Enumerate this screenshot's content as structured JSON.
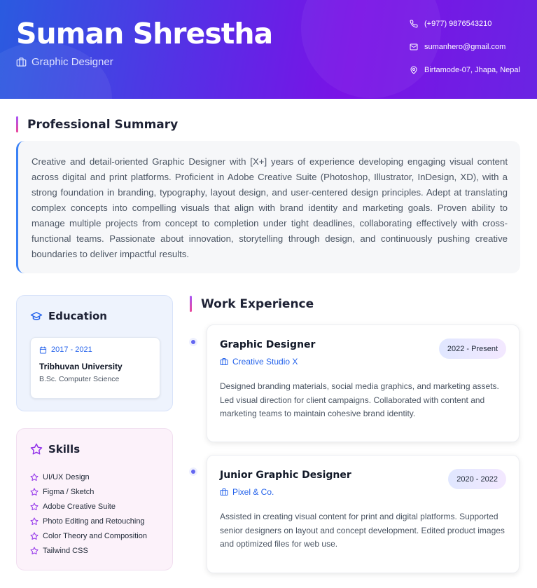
{
  "header": {
    "name": "Suman Shrestha",
    "role": "Graphic Designer",
    "contacts": [
      {
        "icon": "phone-icon",
        "text": "(+977) 9876543210"
      },
      {
        "icon": "mail-icon",
        "text": "sumanhero@gmail.com"
      },
      {
        "icon": "location-icon",
        "text": "Birtamode-07, Jhapa, Nepal"
      }
    ]
  },
  "summary": {
    "title": "Professional Summary",
    "text": "Creative and detail-oriented Graphic Designer with [X+] years of experience developing engaging visual content across digital and print platforms. Proficient in Adobe Creative Suite (Photoshop, Illustrator, InDesign, XD), with a strong foundation in branding, typography, layout design, and user-centered design principles. Adept at translating complex concepts into compelling visuals that align with brand identity and marketing goals. Proven ability to manage multiple projects from concept to completion under tight deadlines, collaborating effectively with cross-functional teams. Passionate about innovation, storytelling through design, and continuously pushing creative boundaries to deliver impactful results."
  },
  "education": {
    "title": "Education",
    "items": [
      {
        "years": "2017 - 2021",
        "school": "Tribhuvan University",
        "degree": "B.Sc. Computer Science"
      }
    ]
  },
  "skills": {
    "title": "Skills",
    "items": [
      "UI/UX Design",
      "Figma / Sketch",
      "Adobe Creative Suite",
      "Photo Editing and Retouching",
      "Color Theory and Composition",
      "Tailwind CSS"
    ]
  },
  "experience": {
    "title": "Work Experience",
    "jobs": [
      {
        "title": "Graphic Designer",
        "company": "Creative Studio X",
        "dates": "2022 - Present",
        "description": "Designed branding materials, social media graphics, and marketing assets. Led visual direction for client campaigns. Collaborated with content and marketing teams to maintain cohesive brand identity."
      },
      {
        "title": "Junior Graphic Designer",
        "company": "Pixel & Co.",
        "dates": "2020 - 2022",
        "description": "Assisted in creating visual content for print and digital platforms. Supported senior designers on layout and concept development. Edited product images and optimized files for web use."
      }
    ]
  },
  "colors": {
    "header_start": "#2a5be0",
    "header_end": "#7a12e6",
    "accent_blue": "#2563eb",
    "accent_purple": "#9333ea"
  }
}
